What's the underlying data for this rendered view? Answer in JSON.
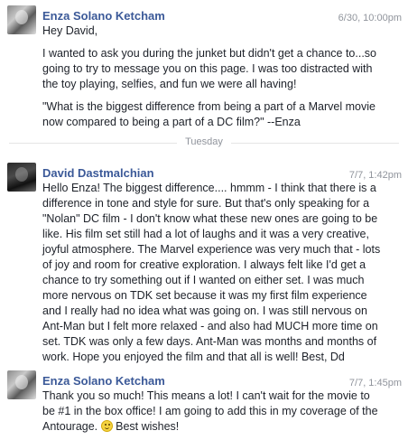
{
  "messages": [
    {
      "sender": "Enza Solano Ketcham",
      "time": "6/30, 10:00pm",
      "lines_p1": [
        "Hey David,"
      ],
      "lines_p2": [
        "I wanted to ask you during the junket but didn't get a chance to...so",
        "going to try to message you on this page.  I was too distracted with",
        "the toy playing, selfies, and fun we were all having!"
      ],
      "lines_p3": [
        "\"What is the biggest difference from being a part of a Marvel movie",
        "now compared to being a part of a DC film?\"  --Enza"
      ]
    },
    {
      "sender": "David Dastmalchian",
      "time": "7/7, 1:42pm",
      "lines": [
        "Hello Enza!  The biggest difference.... hmmm - I think that there is a",
        "difference in tone and style for sure.  But that's only speaking for a",
        "\"Nolan\" DC film - I don't know what these new ones are going to be",
        "like.  His film set still had a lot of laughs and it was a very creative,",
        "joyful atmosphere.  The Marvel experience was very much that - lots",
        "of joy and room for creative exploration.  I always felt like I'd get a",
        "chance to try something out if I wanted on either set.  I was much",
        "more nervous on TDK set because it was my first film experience",
        "and I really had no idea what was going on.  I was still nervous on",
        "Ant-Man but I felt more relaxed - and also had MUCH more time on",
        "set.  TDK was only a few days.  Ant-Man was months and months of",
        "work.  Hope you enjoyed the film and that all is well!  Best, Dd"
      ]
    },
    {
      "sender": "Enza Solano Ketcham",
      "time": "7/7, 1:45pm",
      "lines": [
        "Thank you so much!  This means a lot!  I can't wait for the movie to",
        "be #1 in the box office! I am going to add this in my coverage of the"
      ],
      "last_line_before_emoji": "Antourage. ",
      "emoji": "smiley-emoji",
      "last_line_after_emoji": " Best wishes!"
    }
  ],
  "divider": {
    "label": "Tuesday"
  }
}
